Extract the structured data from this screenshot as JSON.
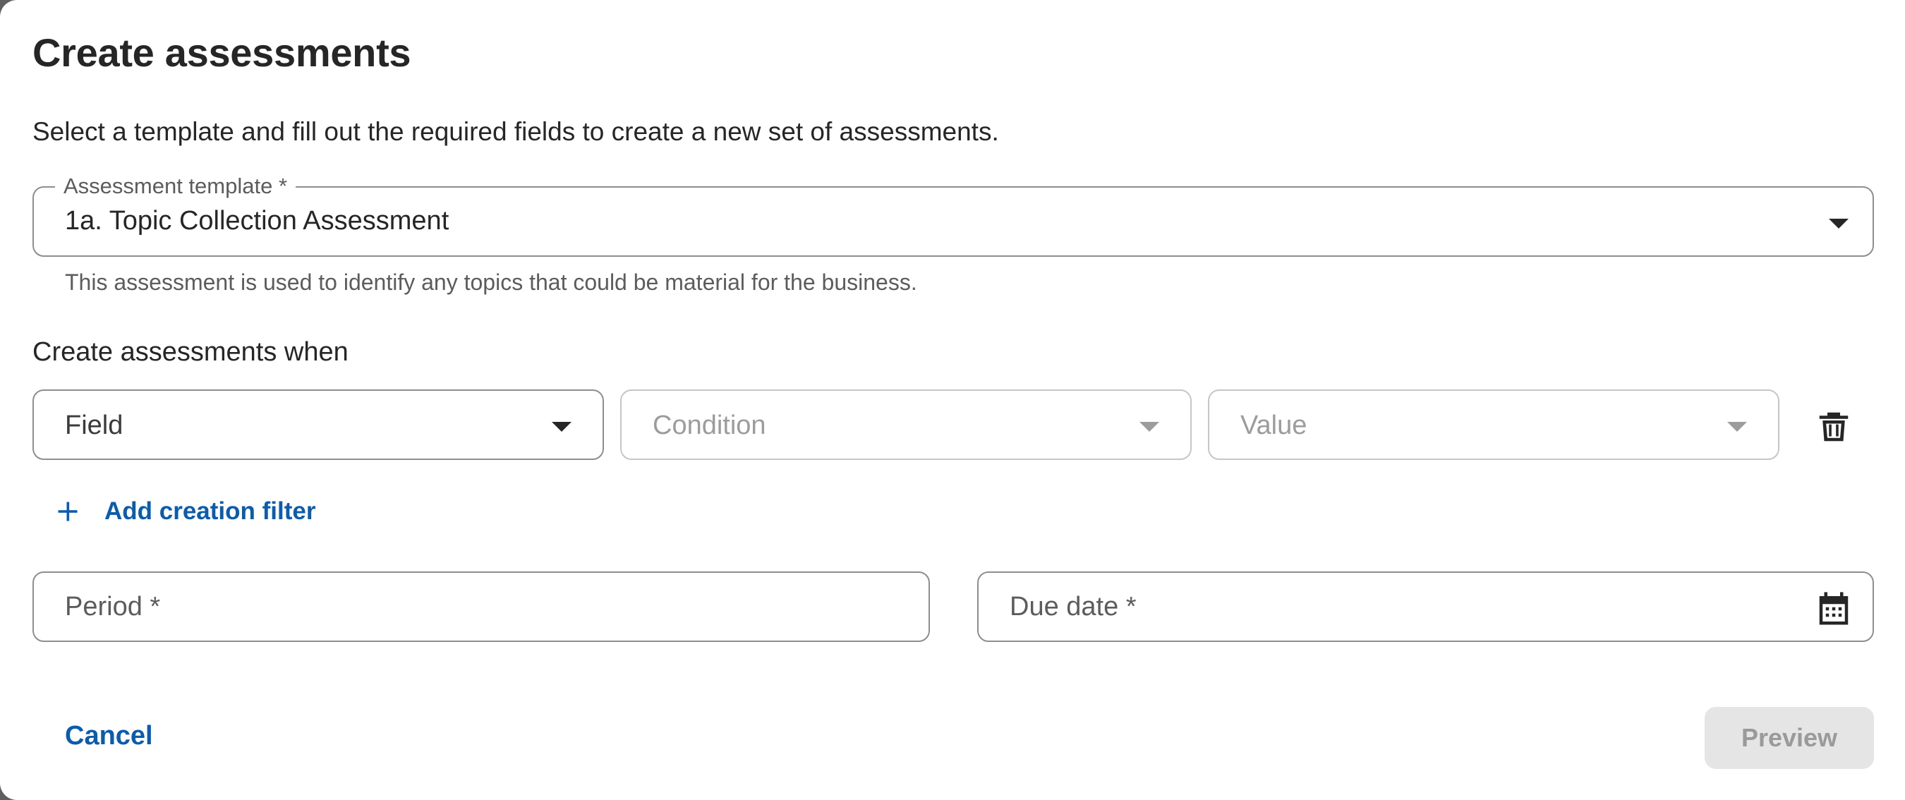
{
  "dialog": {
    "title": "Create assessments",
    "subtitle": "Select a template and fill out the required fields to create a new set of assessments."
  },
  "template_select": {
    "label": "Assessment template *",
    "value": "1a. Topic Collection Assessment",
    "helper": "This assessment is used to identify any topics that could be material for the business."
  },
  "creation_filters": {
    "section_label": "Create assessments when",
    "field_placeholder": "Field",
    "condition_placeholder": "Condition",
    "value_placeholder": "Value",
    "add_filter_label": "Add creation filter"
  },
  "period": {
    "placeholder": "Period *"
  },
  "due_date": {
    "placeholder": "Due date *"
  },
  "footer": {
    "cancel_label": "Cancel",
    "preview_label": "Preview"
  },
  "colors": {
    "accent": "#0b5cad",
    "text": "#262626",
    "border": "#8e8e8e",
    "disabled_border": "#c6c6c6",
    "disabled_button_bg": "#e5e5e5"
  },
  "icons": [
    "chevron-down-icon",
    "trash-icon",
    "plus-icon",
    "calendar-icon"
  ]
}
